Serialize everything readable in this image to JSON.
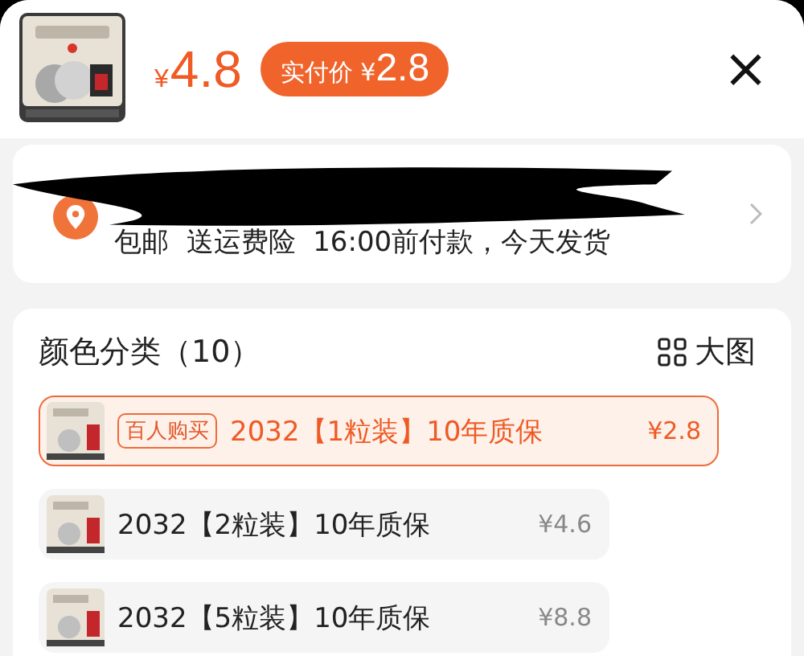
{
  "header": {
    "price": "4.8",
    "currency": "¥",
    "badge": {
      "label": "实付价",
      "currency": "¥",
      "price": "2.8"
    },
    "close": "×"
  },
  "shipping": {
    "redacted": true,
    "text": "包邮  送运费险  16:00前付款，今天发货"
  },
  "options": {
    "title": "颜色分类（10）",
    "view_toggle": "大图",
    "items": [
      {
        "selected": true,
        "tag": "百人购买",
        "label": "2032【1粒装】10年质保",
        "price": "¥2.8"
      },
      {
        "selected": false,
        "label": "2032【2粒装】10年质保",
        "price": "¥4.6"
      },
      {
        "selected": false,
        "label": "2032【5粒装】10年质保",
        "price": "¥8.8"
      }
    ]
  }
}
